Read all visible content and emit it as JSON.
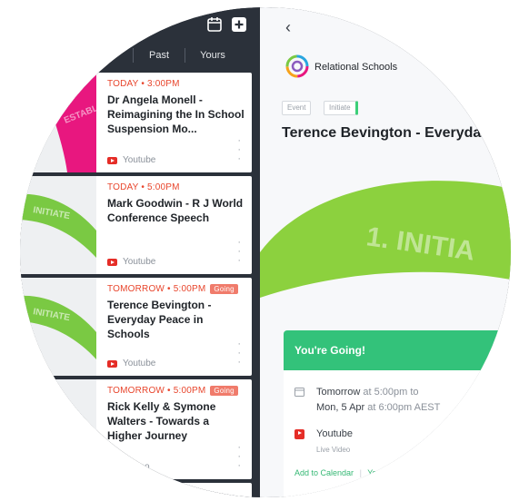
{
  "segments": [
    {
      "label": ""
    },
    {
      "label": "Past"
    },
    {
      "label": "Yours"
    }
  ],
  "events": [
    {
      "when": "TODAY • 3:00PM",
      "going": "",
      "title": "Dr Angela Monell - Reimagining the In School Suspension Mo...",
      "source": "Youtube",
      "thumb_text": "ESTABLISH",
      "thumb_color": "#e8177f"
    },
    {
      "when": "TODAY • 5:00PM",
      "going": "",
      "title": "Mark Goodwin - R J World Conference Speech",
      "source": "Youtube",
      "thumb_text": "INITIATE",
      "thumb_color": "#7ac943"
    },
    {
      "when": "TOMORROW • 5:00PM",
      "going": "Going",
      "title": "Terence Bevington - Everyday Peace in Schools",
      "source": "Youtube",
      "thumb_text": "INITIATE",
      "thumb_color": "#7ac943"
    },
    {
      "when": "TOMORROW • 5:00PM",
      "going": "Going",
      "title": "Rick Kelly & Symone Walters - Towards a Higher Journey",
      "source": "Live Video",
      "thumb_text": "",
      "thumb_color": "#7ac943"
    }
  ],
  "detail": {
    "back": "‹",
    "org": "Relational Schools",
    "tags": [
      "Event",
      "Initiate"
    ],
    "title": "Terence Bevington - Everyda",
    "banner_text": "1. INITIA",
    "going_header": "You're Going!",
    "date_line1_bold": "Tomorrow",
    "date_line1_rest": " at 5:00pm to",
    "date_line2_bold": "Mon, 5 Apr",
    "date_line2_rest": " at 6:00pm AEST",
    "platform": "Youtube",
    "platform_sub": "Live Video",
    "add_calendar": "Add to Calendar",
    "link2": "Youtu"
  },
  "colors": {
    "accent_green": "#33c27a",
    "time_red": "#e8452c",
    "dark_panel": "#2b313a",
    "pink": "#e8177f",
    "lime": "#7ac943"
  }
}
